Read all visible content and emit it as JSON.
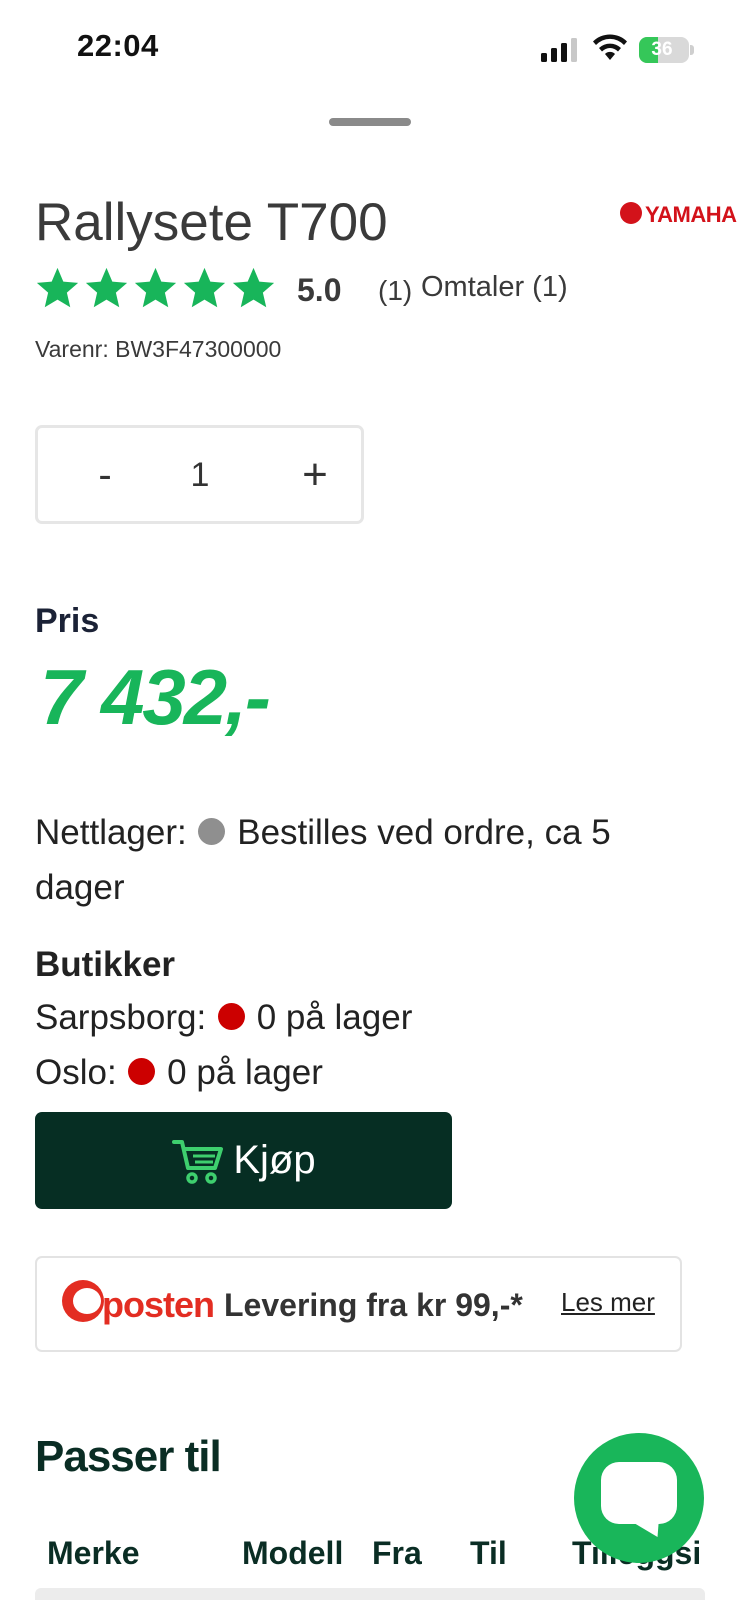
{
  "status_bar": {
    "time": "22:04",
    "battery": "36"
  },
  "product": {
    "title": "Rallysete T700",
    "brand": "YAMAHA",
    "rating": "5.0",
    "rating_count": "(1)",
    "reviews_link": "Omtaler (1)",
    "sku": "Varenr: BW3F47300000"
  },
  "quantity": {
    "minus_label": "-",
    "value": "1",
    "plus_label": "+"
  },
  "price": {
    "label": "Pris",
    "value": "7 432,-"
  },
  "stock": {
    "online_label": "Nettlager:",
    "online_text": "Bestilles ved ordre, ca 5 dager",
    "stores_heading": "Butikker",
    "stores": [
      {
        "name": "Sarpsborg:",
        "text": "0 på lager"
      },
      {
        "name": "Oslo:",
        "text": "0 på lager"
      }
    ]
  },
  "buy_button": {
    "label": "Kjøp"
  },
  "delivery": {
    "carrier": "posten",
    "text": "Levering fra kr 99,-*",
    "link": "Les mer"
  },
  "fits": {
    "heading": "Passer til",
    "columns": [
      "Merke",
      "Modell",
      "Fra",
      "Til",
      "Tilleggsi"
    ]
  },
  "colors": {
    "accent_green": "#18b55a",
    "dark_green": "#062e23",
    "stock_red": "#cc0000",
    "stock_grey": "#8f8f8f",
    "posten_red": "#e32d22",
    "brand_red": "#d3121a"
  }
}
